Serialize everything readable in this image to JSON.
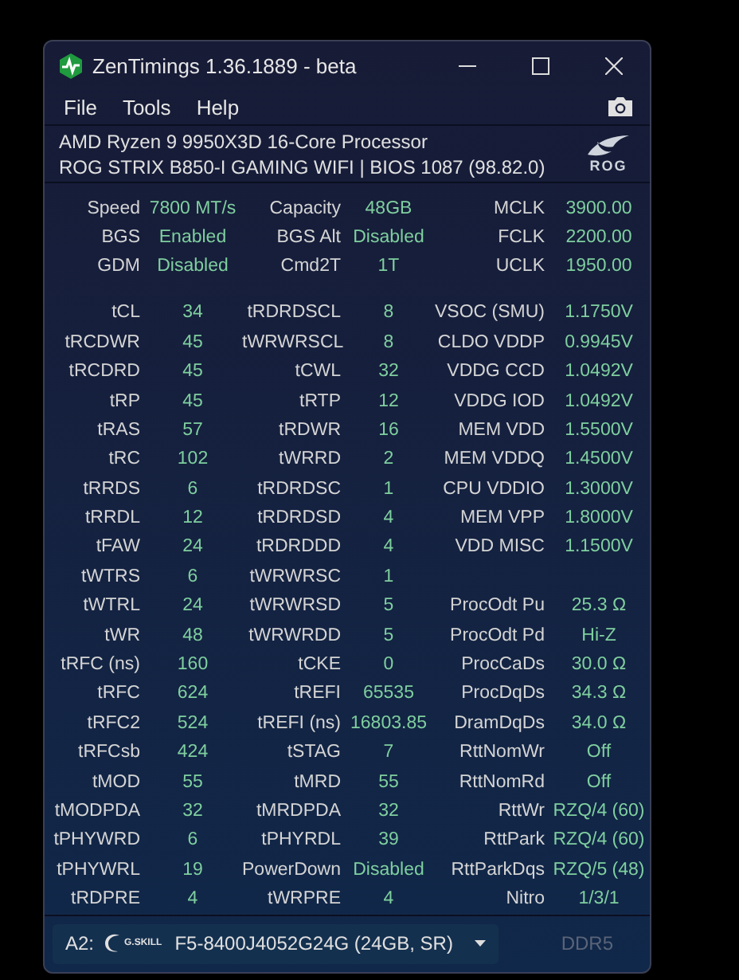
{
  "window": {
    "title": "ZenTimings 1.36.1889 - beta"
  },
  "menu": [
    "File",
    "Tools",
    "Help"
  ],
  "system": {
    "cpu": "AMD Ryzen 9 9950X3D 16-Core Processor",
    "board": "ROG STRIX B850-I GAMING WIFI | BIOS 1087 (98.82.0)",
    "logo": "ROG"
  },
  "summary": [
    [
      {
        "label": "Speed",
        "value": "7800 MT/s"
      },
      {
        "label": "Capacity",
        "value": "48GB"
      },
      {
        "label": "MCLK",
        "value": "3900.00"
      }
    ],
    [
      {
        "label": "BGS",
        "value": "Enabled"
      },
      {
        "label": "BGS Alt",
        "value": "Disabled"
      },
      {
        "label": "FCLK",
        "value": "2200.00"
      }
    ],
    [
      {
        "label": "GDM",
        "value": "Disabled"
      },
      {
        "label": "Cmd2T",
        "value": "1T"
      },
      {
        "label": "UCLK",
        "value": "1950.00"
      }
    ]
  ],
  "timings": [
    [
      {
        "label": "tCL",
        "value": "34"
      },
      {
        "label": "tRDRDSCL",
        "value": "8"
      },
      {
        "label": "VSOC (SMU)",
        "value": "1.1750V"
      }
    ],
    [
      {
        "label": "tRCDWR",
        "value": "45"
      },
      {
        "label": "tWRWRSCL",
        "value": "8"
      },
      {
        "label": "CLDO VDDP",
        "value": "0.9945V"
      }
    ],
    [
      {
        "label": "tRCDRD",
        "value": "45"
      },
      {
        "label": "tCWL",
        "value": "32"
      },
      {
        "label": "VDDG CCD",
        "value": "1.0492V"
      }
    ],
    [
      {
        "label": "tRP",
        "value": "45"
      },
      {
        "label": "tRTP",
        "value": "12"
      },
      {
        "label": "VDDG IOD",
        "value": "1.0492V"
      }
    ],
    [
      {
        "label": "tRAS",
        "value": "57"
      },
      {
        "label": "tRDWR",
        "value": "16"
      },
      {
        "label": "MEM VDD",
        "value": "1.5500V"
      }
    ],
    [
      {
        "label": "tRC",
        "value": "102"
      },
      {
        "label": "tWRRD",
        "value": "2"
      },
      {
        "label": "MEM VDDQ",
        "value": "1.4500V"
      }
    ],
    [
      {
        "label": "tRRDS",
        "value": "6"
      },
      {
        "label": "tRDRDSC",
        "value": "1"
      },
      {
        "label": "CPU VDDIO",
        "value": "1.3000V"
      }
    ],
    [
      {
        "label": "tRRDL",
        "value": "12"
      },
      {
        "label": "tRDRDSD",
        "value": "4"
      },
      {
        "label": "MEM VPP",
        "value": "1.8000V"
      }
    ],
    [
      {
        "label": "tFAW",
        "value": "24"
      },
      {
        "label": "tRDRDDD",
        "value": "4"
      },
      {
        "label": "VDD MISC",
        "value": "1.1500V"
      }
    ],
    [
      {
        "label": "tWTRS",
        "value": "6"
      },
      {
        "label": "tWRWRSC",
        "value": "1"
      }
    ],
    [
      {
        "label": "tWTRL",
        "value": "24"
      },
      {
        "label": "tWRWRSD",
        "value": "5"
      },
      {
        "label": "ProcOdt Pu",
        "value": "25.3 Ω"
      }
    ],
    [
      {
        "label": "tWR",
        "value": "48"
      },
      {
        "label": "tWRWRDD",
        "value": "5"
      },
      {
        "label": "ProcOdt Pd",
        "value": "Hi-Z"
      }
    ],
    [
      {
        "label": "tRFC (ns)",
        "value": "160"
      },
      {
        "label": "tCKE",
        "value": "0"
      },
      {
        "label": "ProcCaDs",
        "value": "30.0 Ω"
      }
    ],
    [
      {
        "label": "tRFC",
        "value": "624"
      },
      {
        "label": "tREFI",
        "value": "65535"
      },
      {
        "label": "ProcDqDs",
        "value": "34.3 Ω"
      }
    ],
    [
      {
        "label": "tRFC2",
        "value": "524"
      },
      {
        "label": "tREFI (ns)",
        "value": "16803.85"
      },
      {
        "label": "DramDqDs",
        "value": "34.0 Ω"
      }
    ],
    [
      {
        "label": "tRFCsb",
        "value": "424"
      },
      {
        "label": "tSTAG",
        "value": "7"
      },
      {
        "label": "RttNomWr",
        "value": "Off"
      }
    ],
    [
      {
        "label": "tMOD",
        "value": "55"
      },
      {
        "label": "tMRD",
        "value": "55"
      },
      {
        "label": "RttNomRd",
        "value": "Off"
      }
    ],
    [
      {
        "label": "tMODPDA",
        "value": "32"
      },
      {
        "label": "tMRDPDA",
        "value": "32"
      },
      {
        "label": "RttWr",
        "value": "RZQ/4 (60)"
      }
    ],
    [
      {
        "label": "tPHYWRD",
        "value": "6"
      },
      {
        "label": "tPHYRDL",
        "value": "39"
      },
      {
        "label": "RttPark",
        "value": "RZQ/4 (60)"
      }
    ],
    [
      {
        "label": "tPHYWRL",
        "value": "19"
      },
      {
        "label": "PowerDown",
        "value": "Disabled"
      },
      {
        "label": "RttParkDqs",
        "value": "RZQ/5 (48)"
      }
    ],
    [
      {
        "label": "tRDPRE",
        "value": "4"
      },
      {
        "label": "tWRPRE",
        "value": "4"
      },
      {
        "label": "Nitro",
        "value": "1/3/1"
      }
    ]
  ],
  "footer": {
    "slot": "A2:",
    "vendor_logo": "G.SKILL",
    "module": "F5-8400J4052G24G (24GB, SR)",
    "memory_type": "DDR5",
    "memory_type_disabled": true
  }
}
